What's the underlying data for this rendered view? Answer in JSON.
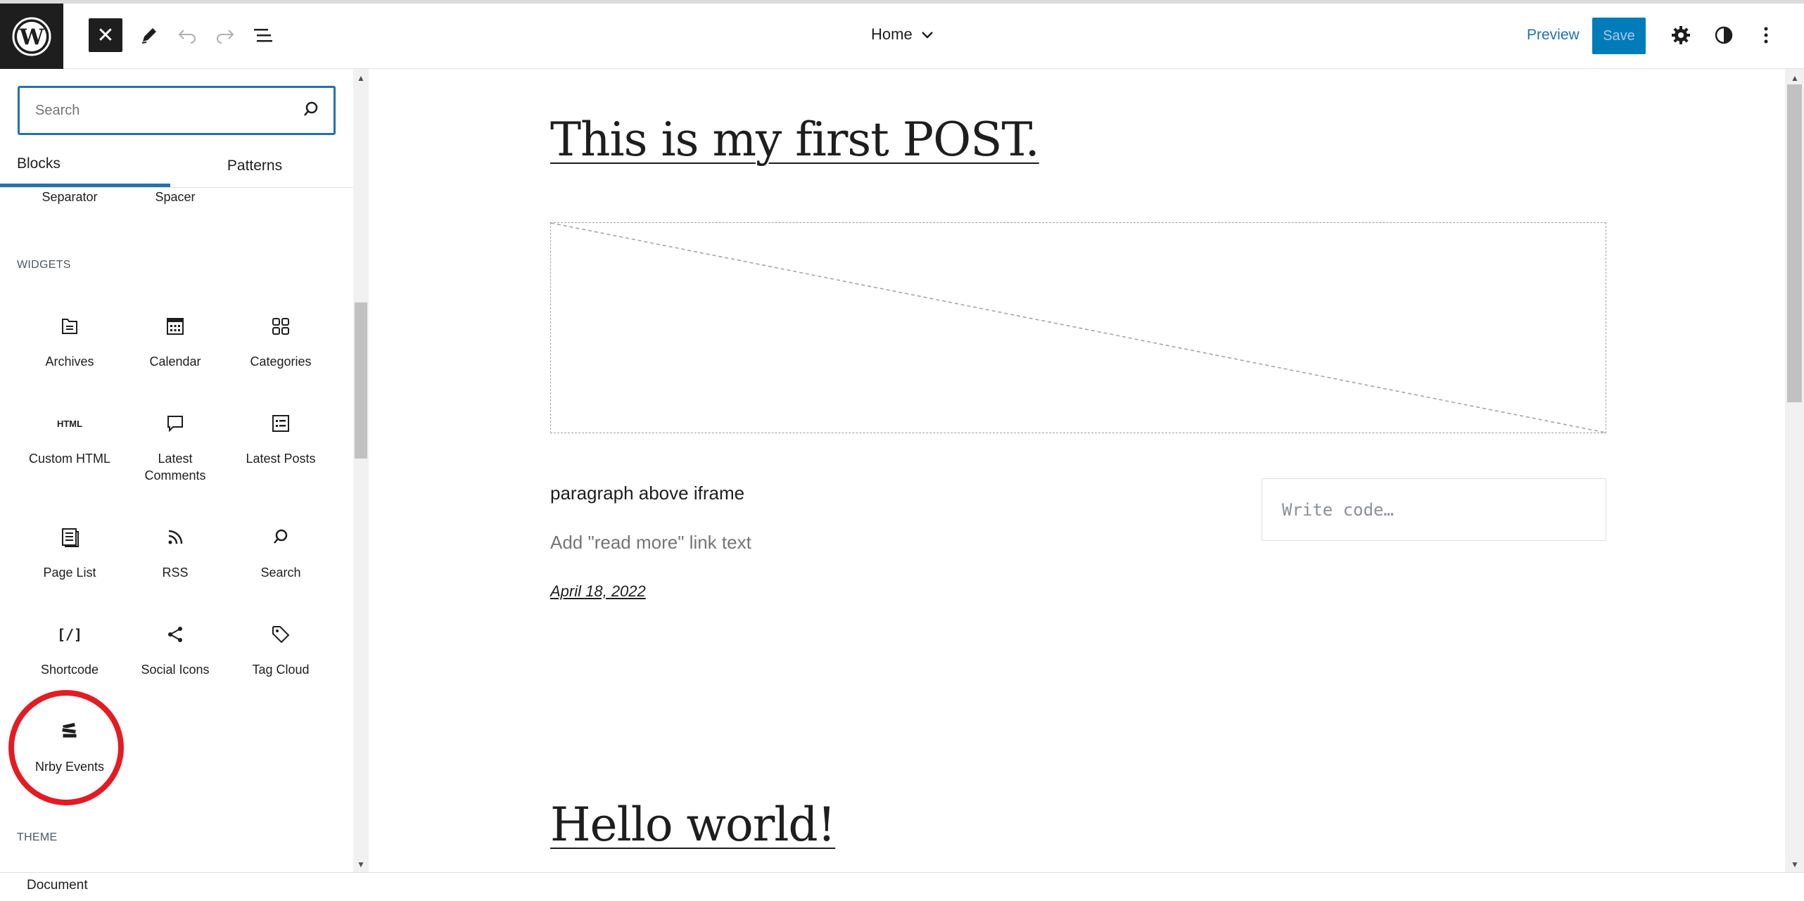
{
  "header": {
    "close_label": "✕",
    "nav_title": "Home",
    "preview_label": "Preview",
    "save_label": "Save"
  },
  "sidebar": {
    "search_placeholder": "Search",
    "tabs": [
      {
        "label": "Blocks",
        "active": true
      },
      {
        "label": "Patterns",
        "active": false
      }
    ],
    "partial_items": [
      "Separator",
      "Spacer"
    ],
    "widgets_title": "WIDGETS",
    "widgets": [
      {
        "label": "Archives",
        "icon": "archive-icon"
      },
      {
        "label": "Calendar",
        "icon": "calendar-icon"
      },
      {
        "label": "Categories",
        "icon": "categories-icon"
      },
      {
        "label": "Custom HTML",
        "icon": "html-icon",
        "glyph": "HTML"
      },
      {
        "label": "Latest Comments",
        "icon": "comment-icon"
      },
      {
        "label": "Latest Posts",
        "icon": "list-icon"
      },
      {
        "label": "Page List",
        "icon": "page-list-icon"
      },
      {
        "label": "RSS",
        "icon": "rss-icon"
      },
      {
        "label": "Search",
        "icon": "search-icon"
      },
      {
        "label": "Shortcode",
        "icon": "shortcode-icon",
        "glyph": "[/]"
      },
      {
        "label": "Social Icons",
        "icon": "share-icon"
      },
      {
        "label": "Tag Cloud",
        "icon": "tag-icon"
      },
      {
        "label": "Nrby Events",
        "icon": "nrby-events-icon",
        "highlighted": true
      }
    ],
    "theme_title": "THEME"
  },
  "canvas": {
    "post1_title": "This is my first POST.",
    "paragraph": "paragraph above iframe",
    "read_more": "Add \"read more\" link text",
    "date": "April 18, 2022",
    "code_placeholder": "Write code…",
    "post2_title": "Hello world!"
  },
  "footer": {
    "breadcrumb": "Document"
  },
  "colors": {
    "accent": "#2271b1",
    "save_bg": "#007cba",
    "highlight": "#e31c23"
  }
}
